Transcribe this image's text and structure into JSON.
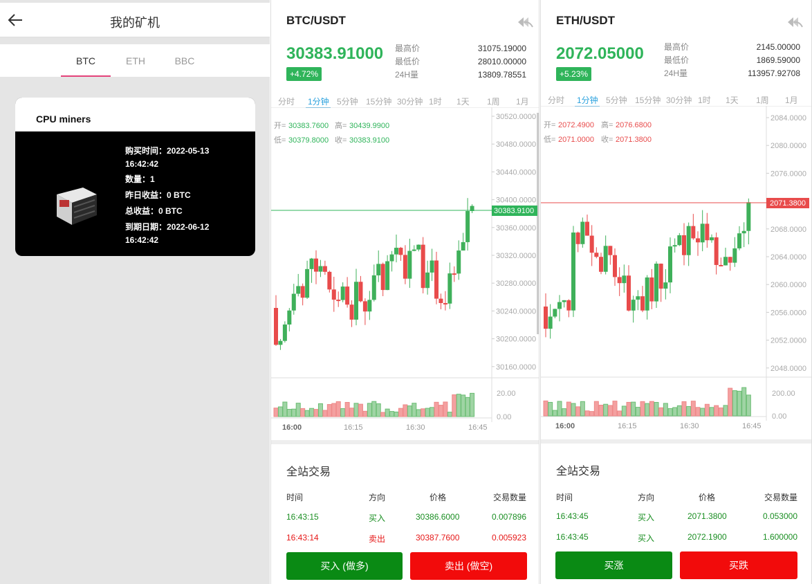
{
  "miner_page": {
    "title": "我的矿机",
    "tabs": [
      "BTC",
      "ETH",
      "BBC"
    ],
    "active_tab": "BTC",
    "card": {
      "title": "CPU miners",
      "lines": [
        "购买时间：2022-05-13",
        "16:42:42",
        "数量：1",
        "昨日收益：0 BTC",
        "总收益：0 BTC",
        "到期日期：2022-06-12",
        "16:42:42"
      ]
    }
  },
  "btc": {
    "pair": "BTC/USDT",
    "price": "30383.91000",
    "change": "+4.72%",
    "stats": [
      {
        "label": "最高价",
        "value": "31075.19000"
      },
      {
        "label": "最低价",
        "value": "28010.00000"
      },
      {
        "label": "24H量",
        "value": "13809.78551"
      }
    ],
    "intervals": [
      "分时",
      "1分钟",
      "5分钟",
      "15分钟",
      "30分钟",
      "1时",
      "1天",
      "1周",
      "1月"
    ],
    "active_interval": "1分钟",
    "ohlc": {
      "open_label": "开=",
      "open": "30383.7600",
      "high_label": "高=",
      "high": "30439.9900",
      "low_label": "低=",
      "low": "30379.8000",
      "close_label": "收=",
      "close": "30383.9100"
    },
    "y_ticks": [
      "30520.0000",
      "30480.0000",
      "30440.0000",
      "30400.0000",
      "30360.0000",
      "30320.0000",
      "30280.0000",
      "30240.0000",
      "30200.0000",
      "30160.0000"
    ],
    "last_price_tag": "30383.9100",
    "vol_ticks": [
      "20.00",
      "0.00"
    ],
    "x_ticks": [
      "16:00",
      "16:15",
      "16:30",
      "16:45"
    ],
    "trade": {
      "title": "全站交易",
      "headers": [
        "时间",
        "方向",
        "价格",
        "交易数量"
      ],
      "rows": [
        {
          "time": "16:43:15",
          "dir": "买入",
          "price": "30386.6000",
          "qty": "0.007896",
          "side": "buy"
        },
        {
          "time": "16:43:14",
          "dir": "卖出",
          "price": "30387.7600",
          "qty": "0.005923",
          "side": "sell"
        }
      ],
      "buy_label": "买入 (做多)",
      "sell_label": "卖出 (做空)"
    }
  },
  "eth": {
    "pair": "ETH/USDT",
    "price": "2072.05000",
    "change": "+5.23%",
    "stats": [
      {
        "label": "最高价",
        "value": "2145.00000"
      },
      {
        "label": "最低价",
        "value": "1869.59000"
      },
      {
        "label": "24H量",
        "value": "113957.92708"
      }
    ],
    "intervals": [
      "分时",
      "1分钟",
      "5分钟",
      "15分钟",
      "30分钟",
      "1时",
      "1天",
      "1周",
      "1月"
    ],
    "active_interval": "1分钟",
    "ohlc": {
      "open_label": "开=",
      "open": "2072.4900",
      "high_label": "高=",
      "high": "2076.6800",
      "low_label": "低=",
      "low": "2071.0000",
      "close_label": "收=",
      "close": "2071.3800"
    },
    "y_ticks": [
      "2084.0000",
      "2080.0000",
      "2076.0000",
      "2072.0000",
      "2068.0000",
      "2064.0000",
      "2060.0000",
      "2056.0000",
      "2052.0000",
      "2048.0000"
    ],
    "last_price_tag": "2071.3800",
    "vol_ticks": [
      "200.00",
      "0.00"
    ],
    "x_ticks": [
      "16:00",
      "16:15",
      "16:30",
      "16:45"
    ],
    "trade": {
      "title": "全站交易",
      "headers": [
        "时间",
        "方向",
        "价格",
        "交易数量"
      ],
      "rows": [
        {
          "time": "16:43:45",
          "dir": "买入",
          "price": "2071.3800",
          "qty": "0.053000",
          "side": "buy"
        },
        {
          "time": "16:43:45",
          "dir": "买入",
          "price": "2072.1900",
          "qty": "1.600000",
          "side": "buy"
        }
      ],
      "buy_label": "买涨",
      "sell_label": "买跌"
    }
  },
  "colors": {
    "up": "#2fb45a",
    "down": "#e84b4b",
    "accent": "#2aa1de",
    "tab_underline": "#e4427a",
    "buy_button": "#0a8a14",
    "sell_button": "#f20b0b"
  }
}
